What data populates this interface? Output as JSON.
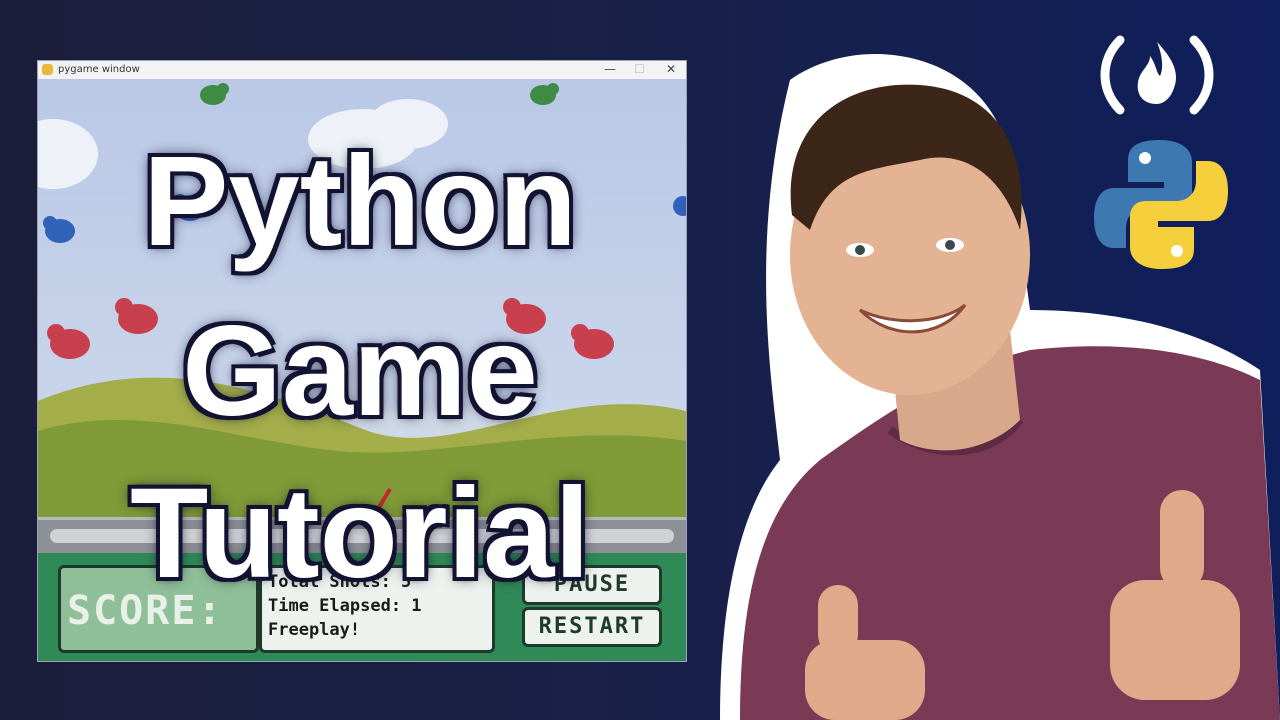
{
  "thumbnail": {
    "title_lines": [
      "Python",
      "Game",
      "Tutorial"
    ]
  },
  "game_window": {
    "title": "pygame window",
    "controls": {
      "minimize": "—",
      "maximize": "☐",
      "close": "✕"
    },
    "hud": {
      "score_label": "SCORE:",
      "stats": [
        "Total Shots: 5",
        "Time Elapsed: 1",
        "Freeplay!"
      ],
      "buttons": [
        "PAUSE",
        "RESTART"
      ]
    }
  },
  "logos": {
    "freecodecamp": "freecodecamp-logo",
    "python": "python-logo"
  },
  "colors": {
    "background": "#1a2046",
    "title_text": "#ffffff",
    "hud_green": "#2f8a57",
    "shirt": "#7a3a55"
  }
}
